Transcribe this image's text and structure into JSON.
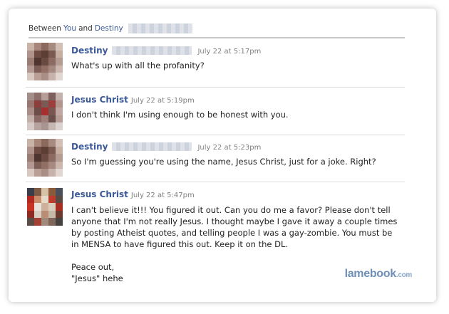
{
  "header": {
    "prefix": "Between",
    "you": "You",
    "and": "and",
    "contact": "Destiny"
  },
  "messages": [
    {
      "sender": "Destiny",
      "time": "July 22 at 5:17pm",
      "text": [
        "What's up with all the profanity?"
      ]
    },
    {
      "sender": "Jesus Christ",
      "time": "July 22 at 5:19pm",
      "text": [
        "I don't think I'm using enough to be honest with you."
      ]
    },
    {
      "sender": "Destiny",
      "time": "July 22 at 5:23pm",
      "text": [
        "So I'm guessing you're using the name, Jesus Christ, just for a joke. Right?"
      ]
    },
    {
      "sender": "Jesus Christ",
      "time": "July 22 at 5:47pm",
      "text": [
        "I can't believe it!!! You figured it out. Can you do me a favor? Please don't tell",
        "anyone that I'm not really Jesus. I thought maybe I gave it away a couple times",
        "by posting Atheist quotes, and telling people I was a gay-zombie. You must be",
        "in MENSA to have figured this out. Keep it on the DL.",
        "",
        "Peace out,",
        "\"Jesus\" hehe"
      ]
    }
  ],
  "watermark": {
    "main": "lamebook",
    "tld": ".com"
  },
  "colors": {
    "link": "#3b5998",
    "timestamp": "#808080",
    "watermark": "#6f8fb8"
  }
}
